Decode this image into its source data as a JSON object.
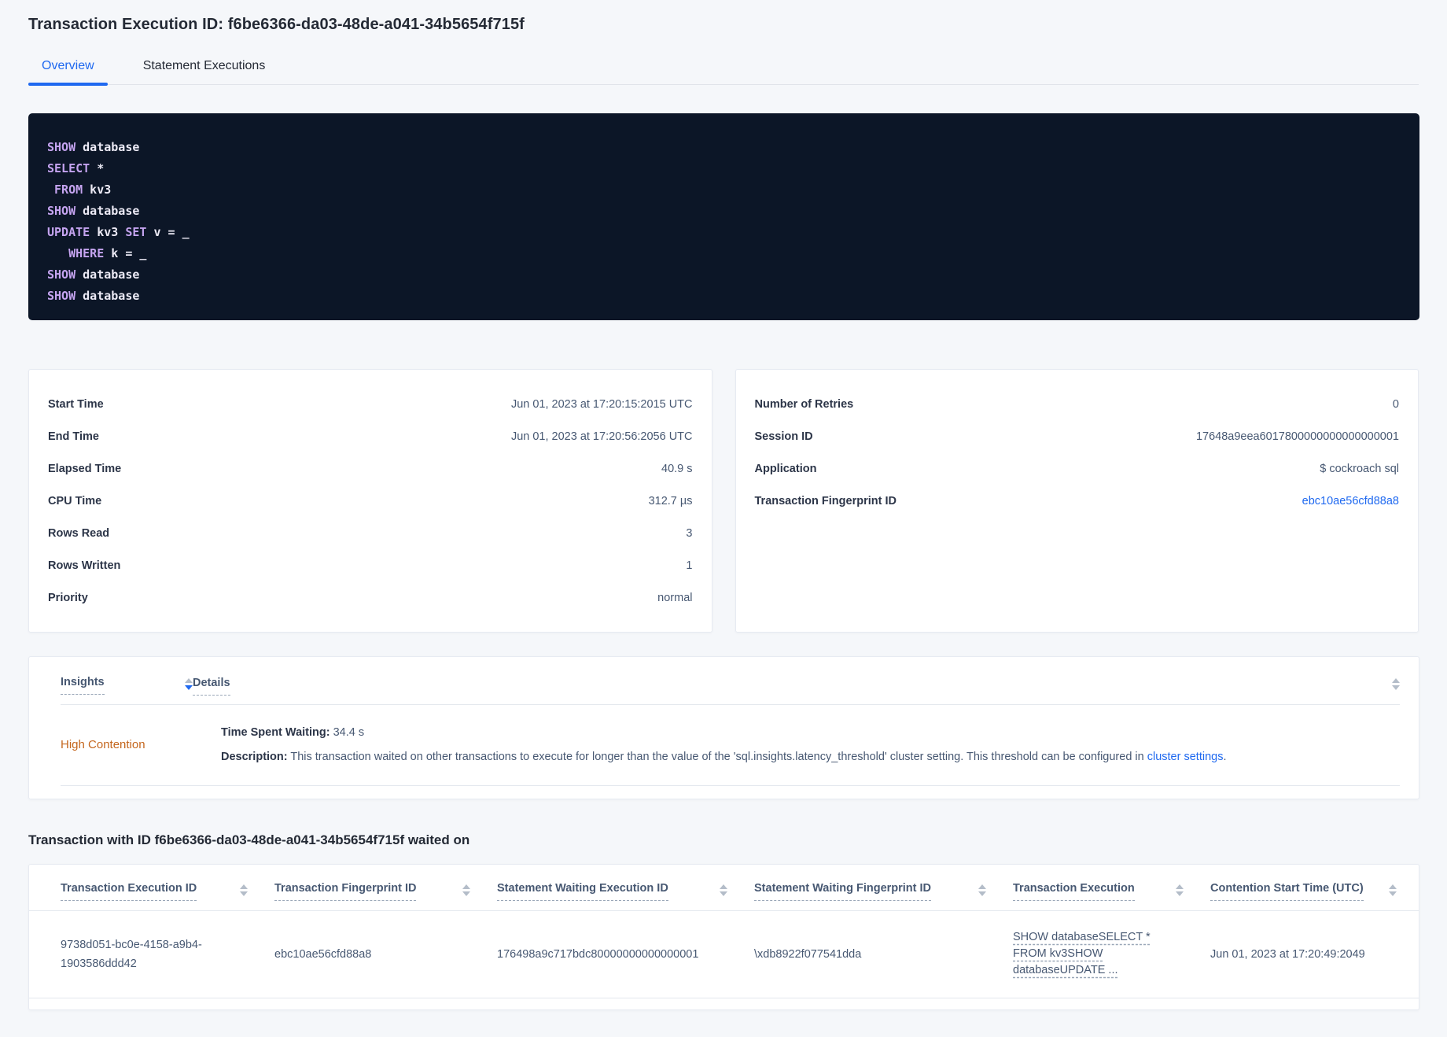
{
  "page": {
    "title": "Transaction Execution ID: f6be6366-da03-48de-a041-34b5654f715f"
  },
  "tabs": [
    {
      "label": "Overview",
      "active": true
    },
    {
      "label": "Statement Executions",
      "active": false
    }
  ],
  "code": {
    "lines": [
      [
        {
          "text": "SHOW",
          "kw": true
        },
        {
          "text": " database",
          "kw": false
        }
      ],
      [
        {
          "text": "SELECT",
          "kw": true
        },
        {
          "text": " *",
          "kw": false
        }
      ],
      [
        {
          "text": " ",
          "kw": false
        },
        {
          "text": "FROM",
          "kw": true
        },
        {
          "text": " kv3",
          "kw": false
        }
      ],
      [
        {
          "text": "SHOW",
          "kw": true
        },
        {
          "text": " database",
          "kw": false
        }
      ],
      [
        {
          "text": "UPDATE",
          "kw": true
        },
        {
          "text": " kv3 ",
          "kw": false
        },
        {
          "text": "SET",
          "kw": true
        },
        {
          "text": " v = _",
          "kw": false
        }
      ],
      [
        {
          "text": "   ",
          "kw": false
        },
        {
          "text": "WHERE",
          "kw": true
        },
        {
          "text": " k = _",
          "kw": false
        }
      ],
      [
        {
          "text": "SHOW",
          "kw": true
        },
        {
          "text": " database",
          "kw": false
        }
      ],
      [
        {
          "text": "SHOW",
          "kw": true
        },
        {
          "text": " database",
          "kw": false
        }
      ]
    ]
  },
  "summary_left": {
    "rows": [
      {
        "label": "Start Time",
        "value": "Jun 01, 2023 at 17:20:15:2015 UTC"
      },
      {
        "label": "End Time",
        "value": "Jun 01, 2023 at 17:20:56:2056 UTC"
      },
      {
        "label": "Elapsed Time",
        "value": "40.9 s"
      },
      {
        "label": "CPU Time",
        "value": "312.7 µs"
      },
      {
        "label": "Rows Read",
        "value": "3"
      },
      {
        "label": "Rows Written",
        "value": "1"
      },
      {
        "label": "Priority",
        "value": "normal"
      }
    ]
  },
  "summary_right": {
    "rows": [
      {
        "label": "Number of Retries",
        "value": "0"
      },
      {
        "label": "Session ID",
        "value": "17648a9eea6017800000000000000001"
      },
      {
        "label": "Application",
        "value": "$ cockroach sql"
      },
      {
        "label": "Transaction Fingerprint ID",
        "value": "ebc10ae56cfd88a8",
        "link": true
      }
    ]
  },
  "insights": {
    "insights_column": "Insights",
    "details_column": "Details",
    "row": {
      "insight": "High Contention",
      "waiting_label": "Time Spent Waiting:",
      "waiting_value": " 34.4 s",
      "description_label": "Description:",
      "description_text": " This transaction waited on other transactions to execute for longer than the value of the 'sql.insights.latency_threshold' cluster setting. This threshold can be configured in ",
      "description_link": "cluster settings",
      "description_suffix": "."
    }
  },
  "waited_on": {
    "heading": "Transaction with ID f6be6366-da03-48de-a041-34b5654f715f waited on",
    "columns": [
      "Transaction Execution ID",
      "Transaction Fingerprint ID",
      "Statement Waiting Execution ID",
      "Statement Waiting Fingerprint ID",
      "Transaction Execution",
      "Contention Start Time (UTC)"
    ],
    "row": {
      "transaction_execution_id": "9738d051-bc0e-4158-a9b4-1903586ddd42",
      "transaction_fingerprint_id": "ebc10ae56cfd88a8",
      "statement_waiting_execution_id": "176498a9c717bdc80000000000000001",
      "statement_waiting_fingerprint_id": "\\xdb8922f077541dda",
      "transaction_execution": "SHOW databaseSELECT * FROM kv3SHOW databaseUPDATE ...",
      "contention_start_time": "Jun 01, 2023 at 17:20:49:2049"
    }
  },
  "icons": {
    "sort_up": "▲",
    "sort_down": "▼"
  },
  "colors": {
    "accent_blue": "#1f69f0",
    "warning_orange": "#c4661d",
    "code_background": "#0c1627",
    "code_keyword": "#c5a4f0",
    "code_plain": "#eceaf5",
    "page_background": "#f5f7fa",
    "heading_text": "#242a35",
    "body_text": "#475872"
  }
}
